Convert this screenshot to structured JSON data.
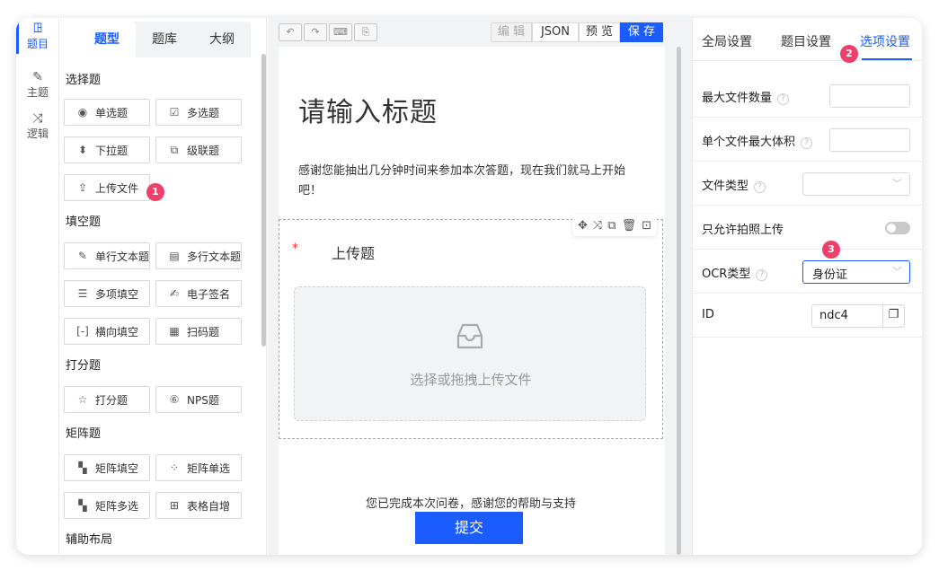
{
  "rail": [
    {
      "icon": "ꖸ",
      "label": "题目"
    },
    {
      "icon": "✎",
      "label": "主题"
    },
    {
      "icon": "⤨",
      "label": "逻辑"
    }
  ],
  "palette": {
    "tabs": [
      "题型",
      "题库",
      "大纲"
    ],
    "sections": {
      "choice": "选择题",
      "fill": "填空题",
      "score": "打分题",
      "matrix": "矩阵题",
      "layout": "辅助布局"
    },
    "buttons": {
      "single": {
        "icon": "◉",
        "label": "单选题"
      },
      "multi": {
        "icon": "☑",
        "label": "多选题"
      },
      "dropdown": {
        "icon": "⬍",
        "label": "下拉题"
      },
      "cascade": {
        "icon": "⧉",
        "label": "级联题"
      },
      "upload": {
        "icon": "⇪",
        "label": "上传文件"
      },
      "single_line": {
        "icon": "✎",
        "label": "单行文本题"
      },
      "multi_line": {
        "icon": "▤",
        "label": "多行文本题"
      },
      "multi_fill": {
        "icon": "☰",
        "label": "多项填空"
      },
      "signature": {
        "icon": "✍",
        "label": "电子签名"
      },
      "horizontal_fill": {
        "icon": "[-]",
        "label": "横向填空"
      },
      "scan": {
        "icon": "▦",
        "label": "扫码题"
      },
      "rating": {
        "icon": "☆",
        "label": "打分题"
      },
      "nps": {
        "icon": "⑥",
        "label": "NPS题"
      },
      "matrix_fill": {
        "icon": "▚",
        "label": "矩阵填空"
      },
      "matrix_single": {
        "icon": "⁘",
        "label": "矩阵单选"
      },
      "matrix_multi": {
        "icon": "▚",
        "label": "矩阵多选"
      },
      "table_auto": {
        "icon": "⊞",
        "label": "表格自增"
      }
    }
  },
  "badges": {
    "b1": "1",
    "b2": "2",
    "b3": "3"
  },
  "toolbar": {
    "edit": "编 辑",
    "json": "JSON",
    "preview": "预 览",
    "save": "保 存"
  },
  "canvas": {
    "title": "请输入标题",
    "intro": "感谢您能抽出几分钟时间来参加本次答题，现在我们就马上开始吧！",
    "question": {
      "required_mark": "*",
      "title": "上传题",
      "upload_hint": "选择或拖拽上传文件"
    },
    "finish": "您已完成本次问卷，感谢您的帮助与支持",
    "submit": "提交"
  },
  "right": {
    "tabs": [
      "全局设置",
      "题目设置",
      "选项设置"
    ],
    "rows": {
      "max_count": {
        "label": "最大文件数量",
        "value": ""
      },
      "max_size": {
        "label": "单个文件最大体积",
        "value": ""
      },
      "file_type": {
        "label": "文件类型",
        "value": ""
      },
      "photo_only": {
        "label": "只允许拍照上传"
      },
      "ocr": {
        "label": "OCR类型",
        "value": "身份证"
      },
      "id": {
        "label": "ID",
        "value": "ndc4"
      }
    }
  }
}
